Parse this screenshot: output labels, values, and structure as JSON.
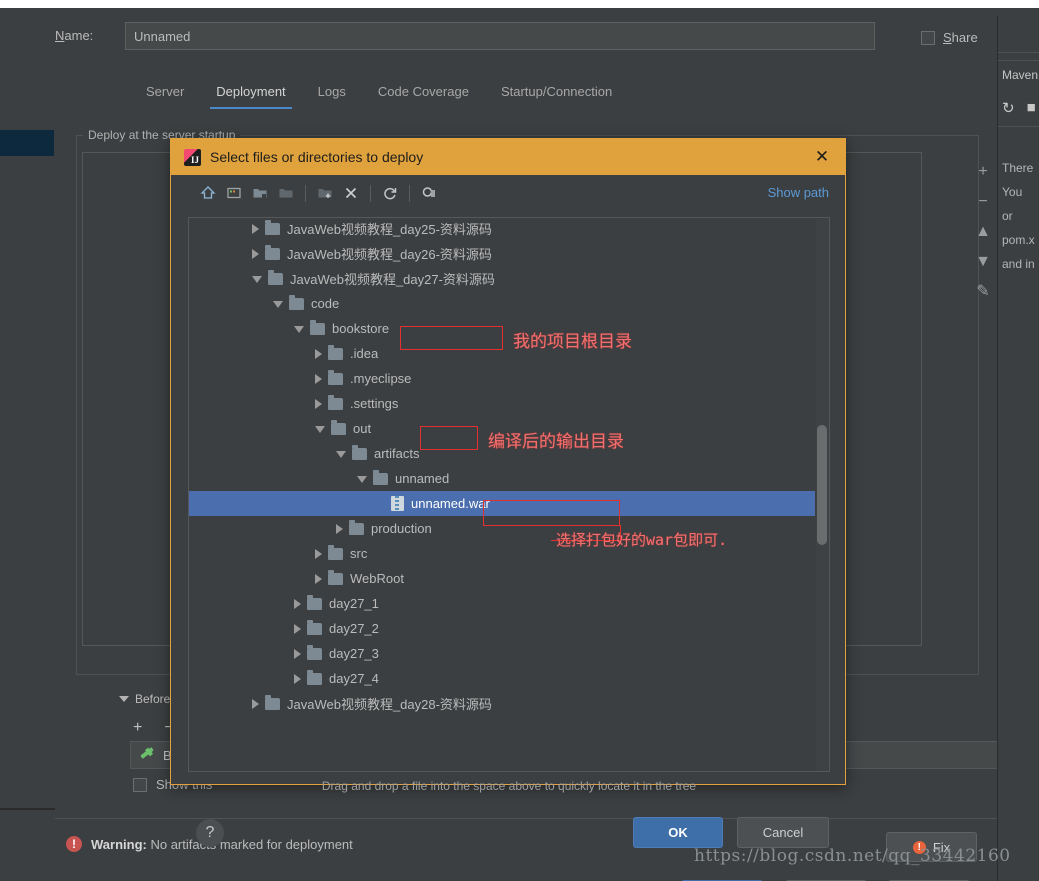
{
  "window": {
    "name_label": "Name:",
    "name_value": "Unnamed",
    "share_label": "Share"
  },
  "tabs": [
    {
      "label": "Server",
      "active": false
    },
    {
      "label": "Deployment",
      "active": true
    },
    {
      "label": "Logs",
      "active": false
    },
    {
      "label": "Code Coverage",
      "active": false
    },
    {
      "label": "Startup/Connection",
      "active": false
    }
  ],
  "deployment": {
    "group_title": "Deploy at the server startup",
    "side_tools": [
      {
        "name": "add-button",
        "glyph": "+"
      },
      {
        "name": "remove-button",
        "glyph": "−"
      },
      {
        "name": "move-up-button",
        "glyph": "▲"
      },
      {
        "name": "move-down-button",
        "glyph": "▼"
      },
      {
        "name": "edit-button",
        "glyph": "✎"
      }
    ]
  },
  "before_launch": {
    "title": "Before launch: B",
    "toolbar": [
      {
        "name": "add-task-button",
        "glyph": "+"
      },
      {
        "name": "remove-task-button",
        "glyph": "−"
      },
      {
        "name": "edit-task-button",
        "glyph": "✎"
      }
    ],
    "item_label": "Build",
    "show_this_label": "Show this"
  },
  "status": {
    "warning_prefix": "Warning:",
    "warning_text": "No artifacts marked for deployment",
    "fix_label": "Fix"
  },
  "maven_panel": {
    "title": "Maven",
    "lines": [
      "There",
      "You",
      "or",
      "pom.x",
      "and in"
    ]
  },
  "dialog": {
    "title": "Select files or directories to deploy",
    "close_glyph": "✕",
    "show_path_label": "Show path",
    "toolbar": [
      {
        "name": "home-icon",
        "glyph": "⌂"
      },
      {
        "name": "desktop-icon",
        "glyph": "⬚"
      },
      {
        "name": "project-folder-icon",
        "glyph": "🗀"
      },
      {
        "name": "hidden-folder-icon",
        "glyph": "🗀"
      },
      {
        "name": "new-folder-icon",
        "glyph": "🗁"
      },
      {
        "name": "delete-icon",
        "glyph": "✕"
      },
      {
        "name": "refresh-icon",
        "glyph": "↻"
      },
      {
        "name": "show-hidden-icon",
        "glyph": "⚙"
      }
    ],
    "drag_hint": "Drag and drop a file into the space above to quickly locate it in the tree",
    "help_glyph": "?",
    "ok_label": "OK",
    "cancel_label": "Cancel",
    "tree": [
      {
        "label": "JavaWeb视频教程_day25-资料源码",
        "indent": 3,
        "state": "collapsed",
        "icon": "folder",
        "selected": false
      },
      {
        "label": "JavaWeb视频教程_day26-资料源码",
        "indent": 3,
        "state": "collapsed",
        "icon": "folder",
        "selected": false
      },
      {
        "label": "JavaWeb视频教程_day27-资料源码",
        "indent": 3,
        "state": "expanded",
        "icon": "folder",
        "selected": false
      },
      {
        "label": "code",
        "indent": 4,
        "state": "expanded",
        "icon": "folder",
        "selected": false
      },
      {
        "label": "bookstore",
        "indent": 5,
        "state": "expanded",
        "icon": "folder",
        "selected": false
      },
      {
        "label": ".idea",
        "indent": 6,
        "state": "collapsed",
        "icon": "folder",
        "selected": false
      },
      {
        "label": ".myeclipse",
        "indent": 6,
        "state": "collapsed",
        "icon": "folder",
        "selected": false
      },
      {
        "label": ".settings",
        "indent": 6,
        "state": "collapsed",
        "icon": "folder",
        "selected": false
      },
      {
        "label": "out",
        "indent": 6,
        "state": "expanded",
        "icon": "folder",
        "selected": false
      },
      {
        "label": "artifacts",
        "indent": 7,
        "state": "expanded",
        "icon": "folder",
        "selected": false
      },
      {
        "label": "unnamed",
        "indent": 8,
        "state": "expanded",
        "icon": "folder",
        "selected": false
      },
      {
        "label": "unnamed.war",
        "indent": 9,
        "state": "leaf",
        "icon": "war",
        "selected": true
      },
      {
        "label": "production",
        "indent": 7,
        "state": "collapsed",
        "icon": "folder",
        "selected": false
      },
      {
        "label": "src",
        "indent": 6,
        "state": "collapsed",
        "icon": "folder",
        "selected": false
      },
      {
        "label": "WebRoot",
        "indent": 6,
        "state": "collapsed",
        "icon": "folder",
        "selected": false
      },
      {
        "label": "day27_1",
        "indent": 5,
        "state": "collapsed",
        "icon": "folder",
        "selected": false
      },
      {
        "label": "day27_2",
        "indent": 5,
        "state": "collapsed",
        "icon": "folder",
        "selected": false
      },
      {
        "label": "day27_3",
        "indent": 5,
        "state": "collapsed",
        "icon": "folder",
        "selected": false
      },
      {
        "label": "day27_4",
        "indent": 5,
        "state": "collapsed",
        "icon": "folder",
        "selected": false
      },
      {
        "label": "JavaWeb视频教程_day28-资料源码",
        "indent": 3,
        "state": "collapsed",
        "icon": "folder",
        "selected": false
      }
    ]
  },
  "annotations": {
    "project_root": "我的项目根目录",
    "output_dir": "编译后的输出目录",
    "select_war": "选择打包好的war包即可."
  },
  "watermark": "https://blog.csdn.net/qq_33442160",
  "colors": {
    "dialog_title_bg": "#e0a23c",
    "selection_blue": "#4b6eaf",
    "accent_link": "#5b9ad6",
    "warning_red": "#c75450",
    "annotation_red": "#e03030"
  }
}
